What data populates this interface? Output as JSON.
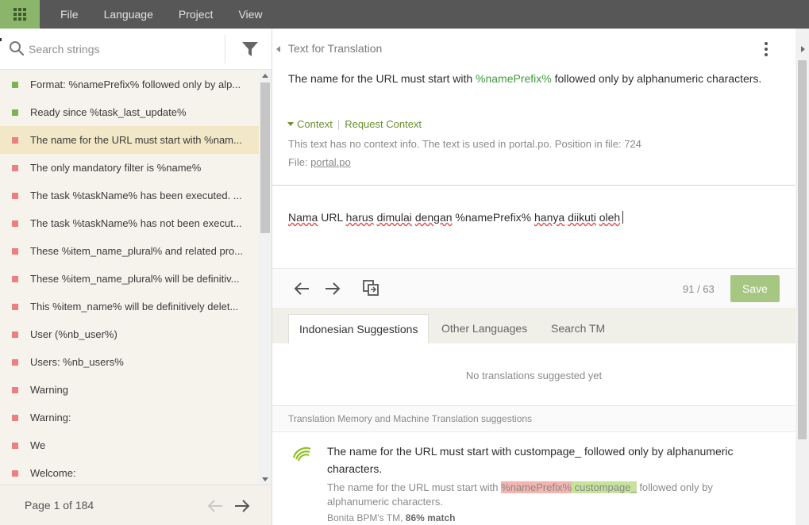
{
  "menu": {
    "apps_icon": "apps-grid-icon",
    "items": [
      "File",
      "Language",
      "Project",
      "View"
    ]
  },
  "colors": {
    "accent_green": "#8ab56a",
    "topbar": "#575757",
    "ready_marker": "#7cb350",
    "untranslated_marker": "#ec7f7f",
    "selected_row": "#f2e7c6"
  },
  "search": {
    "placeholder": "Search strings"
  },
  "strings": [
    {
      "text": "Format: %namePrefix% followed only by alp...",
      "status": "ready"
    },
    {
      "text": "Ready since %task_last_update%",
      "status": "ready"
    },
    {
      "text": "The name for the URL must start with %nam...",
      "status": "untranslated",
      "selected": true
    },
    {
      "text": "The only mandatory filter is %name%",
      "status": "untranslated"
    },
    {
      "text": "The task %taskName% has been executed. ...",
      "status": "untranslated"
    },
    {
      "text": "The task %taskName% has not been execut...",
      "status": "untranslated"
    },
    {
      "text": "These %item_name_plural% and related pro...",
      "status": "untranslated"
    },
    {
      "text": "These %item_name_plural% will be definitiv...",
      "status": "untranslated"
    },
    {
      "text": "This %item_name% will be definitively delet...",
      "status": "untranslated"
    },
    {
      "text": "User (%nb_user%)",
      "status": "untranslated"
    },
    {
      "text": "Users: %nb_users%",
      "status": "untranslated"
    },
    {
      "text": "Warning",
      "status": "untranslated"
    },
    {
      "text": "Warning:",
      "status": "untranslated"
    },
    {
      "text": "We",
      "status": "untranslated"
    },
    {
      "text": "Welcome:",
      "status": "untranslated"
    }
  ],
  "pager": {
    "text": "Page 1 of 184"
  },
  "source": {
    "title": "Text for Translation",
    "text_before": "The name for the URL must start with ",
    "placeholder": "%namePrefix%",
    "text_after": " followed only by alphanumeric characters.",
    "context_label": "Context",
    "request_context": "Request Context",
    "context_info": "This text has no context info. The text is used in portal.po. Position in file: 724",
    "file_label": "File: ",
    "file_name": "portal.po"
  },
  "translation": {
    "words": [
      "Nama",
      "URL",
      "harus",
      "dimulai",
      "dengan",
      "%namePrefix%",
      "hanya",
      "diikuti",
      "oleh"
    ],
    "squiggly": [
      true,
      false,
      true,
      true,
      true,
      false,
      true,
      true,
      true
    ]
  },
  "toolbar": {
    "counter": "91 / 63",
    "save_label": "Save"
  },
  "tabs": [
    "Indonesian Suggestions",
    "Other Languages",
    "Search TM"
  ],
  "suggestions": {
    "empty_text": "No translations suggested yet",
    "tm_header": "Translation Memory and Machine Translation suggestions",
    "tm_main": "The name for the URL must start with custompage_ followed only by alphanumeric characters.",
    "diff_before": "The name for the URL must start with ",
    "diff_deleted": "%namePrefix%",
    "diff_inserted": " custompage_",
    "diff_after": " followed only by alphanumeric characters.",
    "source_name": "Bonita BPM's TM, ",
    "match": "86% match"
  }
}
